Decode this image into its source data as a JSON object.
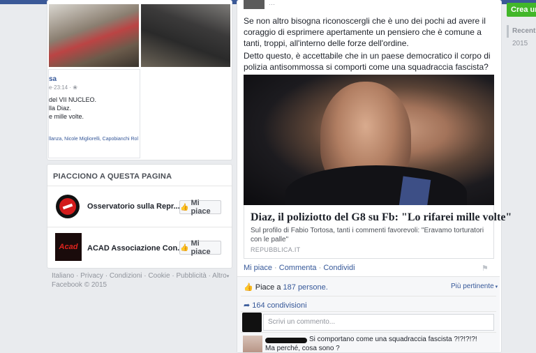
{
  "right_rail": {
    "create_button": "Crea una",
    "recent_label": "Recenti",
    "year": "2015"
  },
  "photo_post": {
    "embedded_name": "sa",
    "embedded_date": "e·23:14 · ❀",
    "embedded_lines": [
      "del VII NUCLEO.",
      "lla Diaz.",
      "e mille volte."
    ],
    "embedded_tags": "llanza, Nicole Migliorelli, Capobianchi Rol"
  },
  "liked_pages": {
    "title": "PIACCIONO A QUESTA PAGINA",
    "items": [
      {
        "name": "Osservatorio sulla Repr...",
        "button": "Mi piace"
      },
      {
        "name": "ACAD Associazione Con...",
        "button": "Mi piace"
      }
    ]
  },
  "footer": {
    "links": [
      "Italiano",
      "Privacy",
      "Condizioni",
      "Cookie",
      "Pubblicità",
      "Altro"
    ],
    "copyright": "Facebook © 2015"
  },
  "post": {
    "paragraph1": "Se non altro bisogna riconoscergli che è uno dei pochi ad avere il coraggio di esprimere apertamente un pensiero che è comune a tanti, troppi, all'interno delle forze dell'ordine.",
    "paragraph2": "Detto questo, è accettabile che in un paese democratico il corpo di polizia antisommossa si comporti come una squadraccia fascista?",
    "link_title": "Diaz, il poliziotto del G8 su Fb: \"Lo rifarei mille volte\"",
    "link_desc": "Sul profilo di Fabio Tortosa, tanti i commenti favorevoli: \"Eravamo torturatori con le palle\"",
    "link_domain": "REPUBBLICA.IT",
    "actions": {
      "like": "Mi piace",
      "comment": "Commenta",
      "share": "Condividi"
    },
    "likes_prefix": "Piace a",
    "likes_count": "187 persone.",
    "sort_label": "Più pertinente",
    "shares": "164 condivisioni",
    "comment_placeholder": "Scrivi un commento...",
    "comment_text": "Si comportano come una squadraccia fascista ?!?!?!?!",
    "comment_reply": "Ma perché, cosa sono ?"
  }
}
